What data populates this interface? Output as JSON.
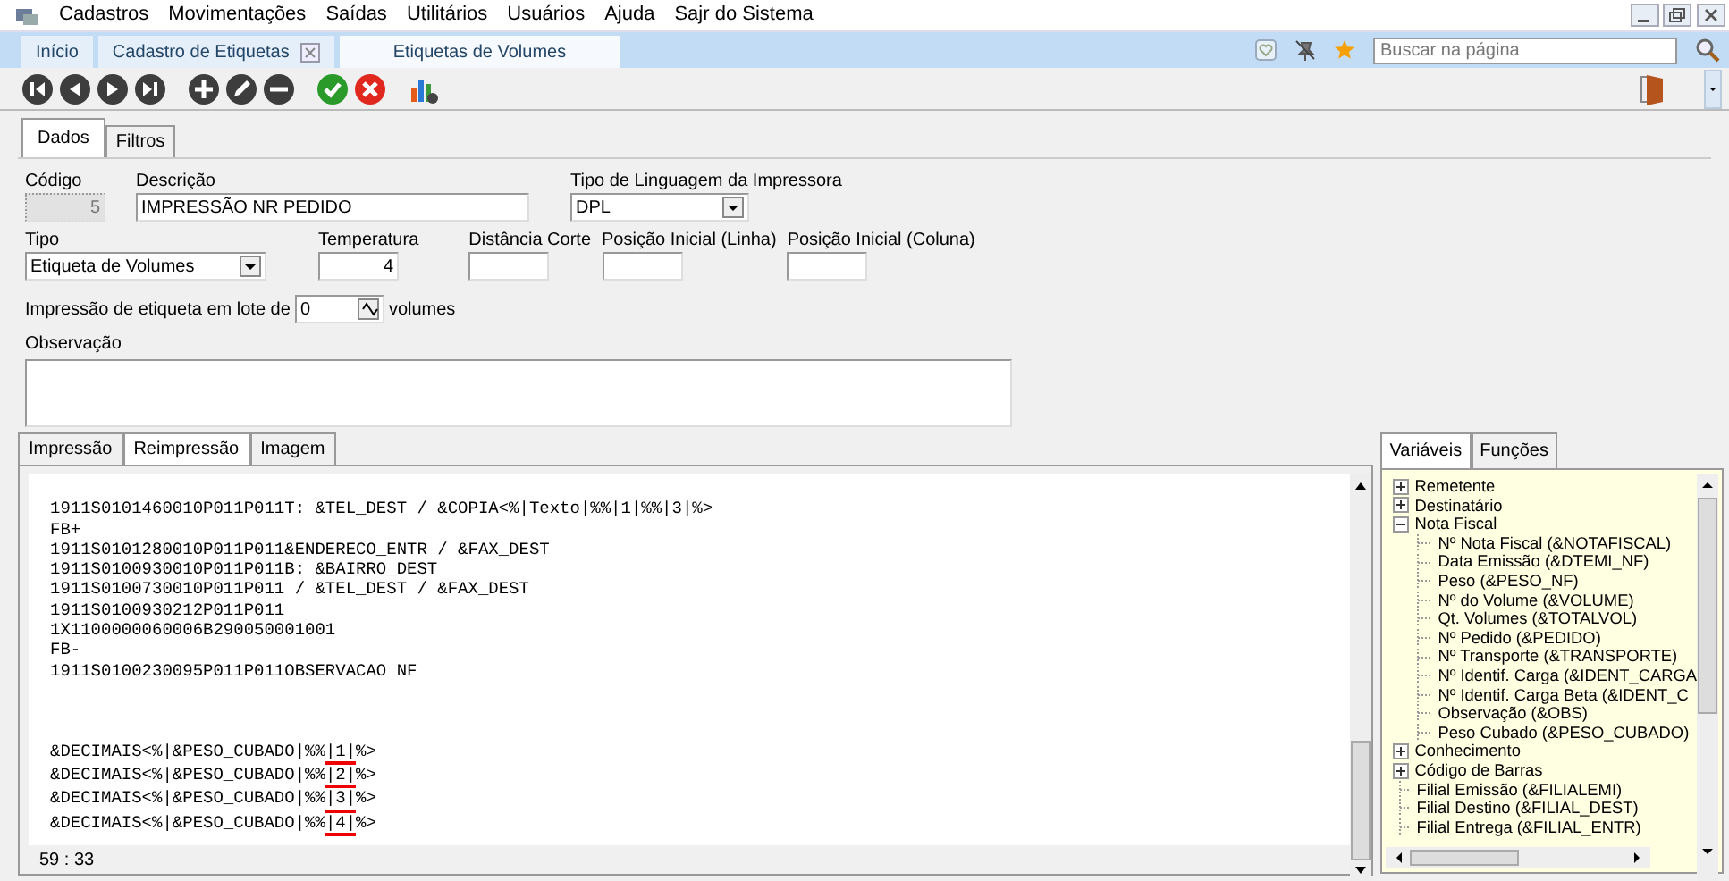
{
  "menu": [
    {
      "label": "Cadastros"
    },
    {
      "label": "Movimentações"
    },
    {
      "label": "Saídas"
    },
    {
      "label": "Utilitários"
    },
    {
      "label": "Usuários"
    },
    {
      "label": "Ajuda"
    },
    {
      "label": "Sajr do Sistema"
    }
  ],
  "tabs": [
    {
      "label": "Início",
      "selected": false,
      "closable": false
    },
    {
      "label": "Cadastro de Etiquetas",
      "selected": false,
      "closable": true
    },
    {
      "label": "Etiquetas de Volumes",
      "selected": true,
      "closable": false
    }
  ],
  "search": {
    "placeholder": "Buscar na página"
  },
  "form_tabs": [
    {
      "label": "Dados",
      "selected": true
    },
    {
      "label": "Filtros",
      "selected": false
    }
  ],
  "form_rows": [
    [
      {
        "label": "Código",
        "value": "5",
        "kind": "number",
        "disabled": true
      },
      {
        "label": "Descrição",
        "value": "IMPRESSÃO NR PEDIDO",
        "kind": "text",
        "disabled": false
      },
      {
        "label": "Tipo de Linguagem da Impressora",
        "value": "DPL",
        "kind": "select",
        "disabled": false
      }
    ],
    [
      {
        "label": "Tipo",
        "value": "Etiqueta de Volumes",
        "kind": "select",
        "disabled": false
      },
      {
        "label": "Temperatura",
        "value": "4",
        "kind": "number",
        "disabled": false
      },
      {
        "label": "Distância Corte",
        "kind": "text",
        "disabled": false
      },
      {
        "label": "Posição Inicial (Linha)",
        "kind": "text",
        "disabled": false
      },
      {
        "label": "Posição Inicial (Coluna)",
        "kind": "text",
        "disabled": false
      }
    ]
  ],
  "batch": {
    "label": "Impressão de etiqueta em lote de",
    "value": "0",
    "suffix": "volumes"
  },
  "observation": {
    "label": "Observação"
  },
  "editor_tabs": [
    {
      "label": "Impressão",
      "selected": false
    },
    {
      "label": "Reimpressão",
      "selected": true
    },
    {
      "label": "Imagem",
      "selected": false
    }
  ],
  "code_lines": [
    {
      "kind": "blank"
    },
    {
      "kind": "line",
      "text": "1911S0101460010P011P011T: &TEL_DEST / &COPIA<%|Texto|%%|1|%%|3|%>"
    },
    {
      "kind": "line",
      "text": "FB+"
    },
    {
      "kind": "line",
      "text": "1911S0101280010P011P011&ENDERECO_ENTR / &FAX_DEST"
    },
    {
      "kind": "line",
      "text": "1911S0100930010P011P011B: &BAIRRO_DEST"
    },
    {
      "kind": "line",
      "text": "1911S0100730010P011P011 / &TEL_DEST / &FAX_DEST"
    },
    {
      "kind": "line",
      "text": "1911S0100930212P011P011"
    },
    {
      "kind": "line",
      "text": "1X1100000060006B290050001001"
    },
    {
      "kind": "line",
      "text": "FB-"
    },
    {
      "kind": "line",
      "text": "1911S0100230095P011P011OBSERVACAO NF"
    },
    {
      "kind": "blank"
    },
    {
      "kind": "blank"
    },
    {
      "kind": "blank"
    },
    {
      "kind": "marked",
      "before": "&DECIMAIS<%|&PESO_CUBADO|%%",
      "marked": "|1|",
      "after": "%>"
    },
    {
      "kind": "marked",
      "before": "&DECIMAIS<%|&PESO_CUBADO|%%",
      "marked": "|2|",
      "after": "%>"
    },
    {
      "kind": "marked",
      "before": "&DECIMAIS<%|&PESO_CUBADO|%%",
      "marked": "|3|",
      "after": "%>"
    },
    {
      "kind": "marked",
      "before": "&DECIMAIS<%|&PESO_CUBADO|%%",
      "marked": "|4|",
      "after": "%>"
    }
  ],
  "cursor_position": "59 : 33",
  "side_tabs": [
    {
      "label": "Variáveis",
      "selected": true
    },
    {
      "label": "Funções",
      "selected": false
    }
  ],
  "tree": [
    {
      "label": "Remetente",
      "expanded": false
    },
    {
      "label": "Destinatário",
      "expanded": false
    },
    {
      "label": "Nota Fiscal",
      "expanded": true,
      "children": [
        {
          "label": "Nº Nota Fiscal (&NOTAFISCAL)"
        },
        {
          "label": "Data Emissão (&DTEMI_NF)"
        },
        {
          "label": "Peso (&PESO_NF)"
        },
        {
          "label": "Nº do Volume (&VOLUME)"
        },
        {
          "label": "Qt. Volumes (&TOTALVOL)"
        },
        {
          "label": "Nº Pedido (&PEDIDO)"
        },
        {
          "label": "Nº Transporte (&TRANSPORTE)"
        },
        {
          "label": "Nº Identif. Carga (&IDENT_CARGA"
        },
        {
          "label": "Nº Identif. Carga Beta (&IDENT_C"
        },
        {
          "label": "Observação (&OBS)"
        },
        {
          "label": "Peso Cubado (&PESO_CUBADO)"
        }
      ]
    },
    {
      "label": "Conhecimento",
      "expanded": false
    },
    {
      "label": "Código de Barras",
      "expanded": false
    },
    {
      "label": "Filial Emissão (&FILIALEMI)"
    },
    {
      "label": "Filial Destino (&FILIAL_DEST)"
    },
    {
      "label": "Filial Entrega (&FILIAL_ENTR)"
    }
  ]
}
